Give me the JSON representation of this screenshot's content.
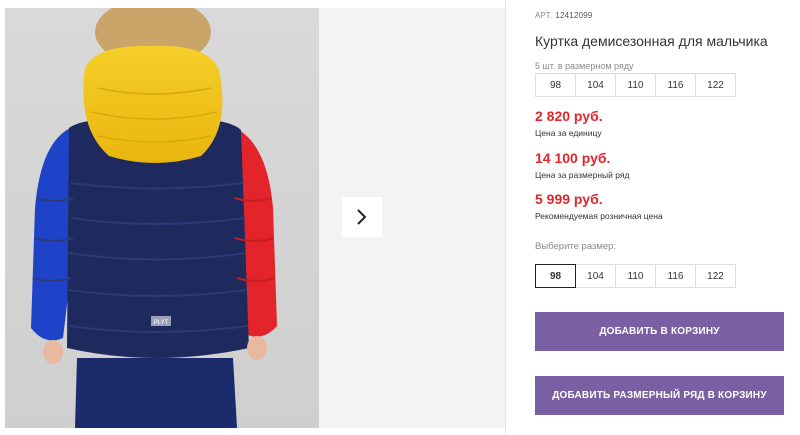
{
  "product": {
    "article_label": "АРТ.",
    "article_value": "12412099",
    "title": "Куртка демисезонная для мальчика"
  },
  "size_row": {
    "label": "5 шт. в размерном ряду",
    "sizes": [
      "98",
      "104",
      "110",
      "116",
      "122"
    ]
  },
  "prices": [
    {
      "amount": "2 820 руб.",
      "note": "Цена за единицу"
    },
    {
      "amount": "14 100 руб.",
      "note": "Цена за размерный ряд"
    },
    {
      "amount": "5 999 руб.",
      "note": "Рекомендуемая розничная цена"
    }
  ],
  "size_select": {
    "label": "Выберите размер:",
    "sizes": [
      "98",
      "104",
      "110",
      "116",
      "122"
    ],
    "selected": "98"
  },
  "buttons": {
    "add_to_cart": "ДОБАВИТЬ В КОРЗИНУ",
    "add_row_to_cart": "ДОБАВИТЬ РАЗМЕРНЫЙ РЯД В КОРЗИНУ"
  },
  "photo": {
    "label_patch_text": "PLYT"
  },
  "colors": {
    "price": "#e1262b",
    "button": "#7a5fa2",
    "jacket_body": "#1e2a5e",
    "jacket_hood": "#f2c21a",
    "sleeve_left": "#1f43c8",
    "sleeve_right": "#e3242b"
  },
  "icons": {
    "next": "chevron-right-icon"
  }
}
